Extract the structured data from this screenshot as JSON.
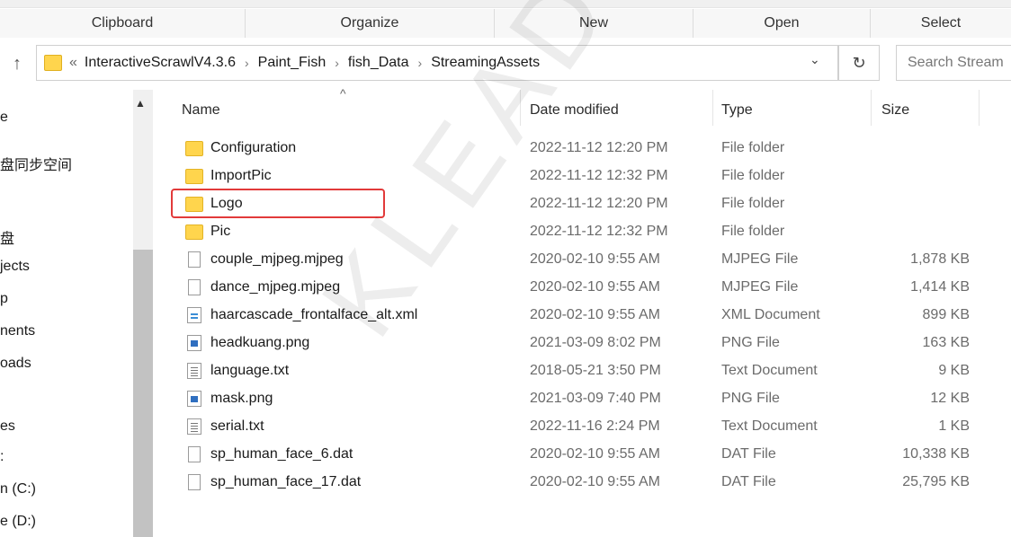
{
  "ribbon": {
    "groups": [
      "Clipboard",
      "Organize",
      "New",
      "Open",
      "Select"
    ]
  },
  "address": {
    "crumbs": [
      "InteractiveScrawlV4.3.6",
      "Paint_Fish",
      "fish_Data",
      "StreamingAssets"
    ],
    "overflow": "«",
    "search_placeholder": "Search Stream"
  },
  "nav": {
    "items": [
      "e",
      "盘同步空间",
      "盘",
      "jects",
      "p",
      "nents",
      "oads",
      "es",
      ":",
      "n (C:)",
      "e (D:)"
    ]
  },
  "columns": {
    "name": "Name",
    "date": "Date modified",
    "type": "Type",
    "size": "Size"
  },
  "files": [
    {
      "icon": "folder-icon",
      "name": "Configuration",
      "date": "2022-11-12 12:20 PM",
      "type": "File folder",
      "size": ""
    },
    {
      "icon": "folder-icon",
      "name": "ImportPic",
      "date": "2022-11-12 12:32 PM",
      "type": "File folder",
      "size": ""
    },
    {
      "icon": "folder-icon",
      "name": "Logo",
      "date": "2022-11-12 12:20 PM",
      "type": "File folder",
      "size": ""
    },
    {
      "icon": "folder-icon",
      "name": "Pic",
      "date": "2022-11-12 12:32 PM",
      "type": "File folder",
      "size": ""
    },
    {
      "icon": "file-icon",
      "name": "couple_mjpeg.mjpeg",
      "date": "2020-02-10 9:55 AM",
      "type": "MJPEG File",
      "size": "1,878 KB"
    },
    {
      "icon": "file-icon",
      "name": "dance_mjpeg.mjpeg",
      "date": "2020-02-10 9:55 AM",
      "type": "MJPEG File",
      "size": "1,414 KB"
    },
    {
      "icon": "xml-file-icon",
      "name": "haarcascade_frontalface_alt.xml",
      "date": "2020-02-10 9:55 AM",
      "type": "XML Document",
      "size": "899 KB"
    },
    {
      "icon": "image-file-icon",
      "name": "headkuang.png",
      "date": "2021-03-09 8:02 PM",
      "type": "PNG File",
      "size": "163 KB"
    },
    {
      "icon": "text-file-icon",
      "name": "language.txt",
      "date": "2018-05-21 3:50 PM",
      "type": "Text Document",
      "size": "9 KB"
    },
    {
      "icon": "image-file-icon",
      "name": "mask.png",
      "date": "2021-03-09 7:40 PM",
      "type": "PNG File",
      "size": "12 KB"
    },
    {
      "icon": "text-file-icon",
      "name": "serial.txt",
      "date": "2022-11-16 2:24 PM",
      "type": "Text Document",
      "size": "1 KB"
    },
    {
      "icon": "file-icon",
      "name": "sp_human_face_6.dat",
      "date": "2020-02-10 9:55 AM",
      "type": "DAT File",
      "size": "10,338 KB"
    },
    {
      "icon": "file-icon",
      "name": "sp_human_face_17.dat",
      "date": "2020-02-10 9:55 AM",
      "type": "DAT File",
      "size": "25,795 KB"
    }
  ],
  "watermark": "KLEADER",
  "colors": {
    "highlight": "#e23a3a",
    "folder": "#ffd54d"
  }
}
